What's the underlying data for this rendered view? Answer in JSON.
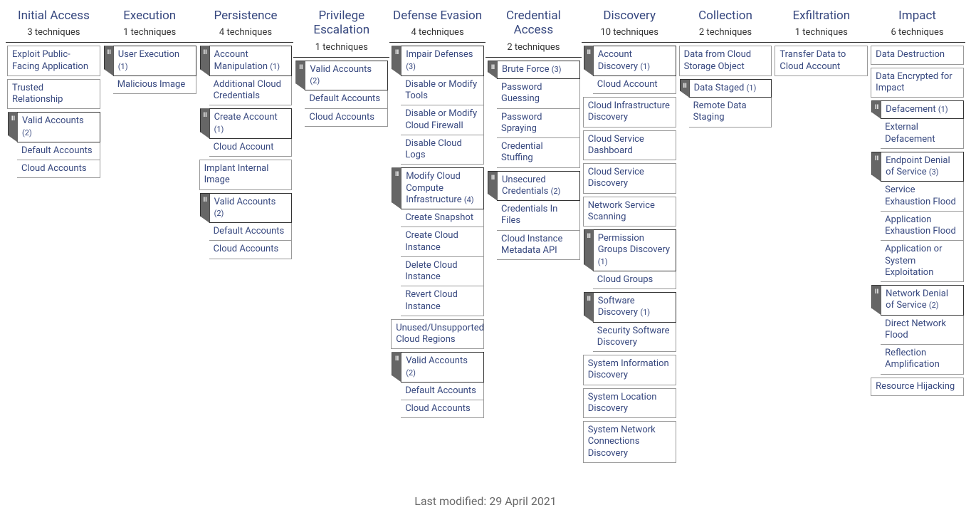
{
  "footer": "Last modified: 29 April 2021",
  "columns": [
    {
      "title": "Initial Access",
      "count": "3 techniques",
      "items": [
        {
          "type": "plain",
          "label": "Exploit Public-Facing Application"
        },
        {
          "type": "plain",
          "label": "Trusted Relationship"
        },
        {
          "type": "parent",
          "label": "Valid Accounts",
          "n": "(2)",
          "subs": [
            {
              "label": "Default Accounts"
            },
            {
              "label": "Cloud Accounts"
            }
          ]
        }
      ]
    },
    {
      "title": "Execution",
      "count": "1 techniques",
      "items": [
        {
          "type": "parent",
          "label": "User Execution",
          "n": "(1)",
          "subs": [
            {
              "label": "Malicious Image"
            }
          ]
        }
      ]
    },
    {
      "title": "Persistence",
      "count": "4 techniques",
      "items": [
        {
          "type": "parent",
          "label": "Account Manipulation",
          "n": "(1)",
          "subs": [
            {
              "label": "Additional Cloud Credentials"
            }
          ]
        },
        {
          "type": "parent",
          "label": "Create Account",
          "n": "(1)",
          "subs": [
            {
              "label": "Cloud Account"
            }
          ]
        },
        {
          "type": "plain",
          "label": "Implant Internal Image"
        },
        {
          "type": "parent",
          "label": "Valid Accounts",
          "n": "(2)",
          "subs": [
            {
              "label": "Default Accounts"
            },
            {
              "label": "Cloud Accounts"
            }
          ]
        }
      ]
    },
    {
      "title": "Privilege Escalation",
      "count": "1 techniques",
      "items": [
        {
          "type": "parent",
          "label": "Valid Accounts",
          "n": "(2)",
          "subs": [
            {
              "label": "Default Accounts"
            },
            {
              "label": "Cloud Accounts"
            }
          ]
        }
      ]
    },
    {
      "title": "Defense Evasion",
      "count": "4 techniques",
      "items": [
        {
          "type": "parent",
          "label": "Impair Defenses",
          "n": "(3)",
          "subs": [
            {
              "label": "Disable or Modify Tools"
            },
            {
              "label": "Disable or Modify Cloud Firewall"
            },
            {
              "label": "Disable Cloud Logs"
            }
          ]
        },
        {
          "type": "parent",
          "label": "Modify Cloud Compute Infrastructure",
          "n": "(4)",
          "subs": [
            {
              "label": "Create Snapshot"
            },
            {
              "label": "Create Cloud Instance"
            },
            {
              "label": "Delete Cloud Instance"
            },
            {
              "label": "Revert Cloud Instance"
            }
          ]
        },
        {
          "type": "plain",
          "label": "Unused/Unsupported Cloud Regions"
        },
        {
          "type": "parent",
          "label": "Valid Accounts",
          "n": "(2)",
          "subs": [
            {
              "label": "Default Accounts"
            },
            {
              "label": "Cloud Accounts"
            }
          ]
        }
      ]
    },
    {
      "title": "Credential Access",
      "count": "2 techniques",
      "items": [
        {
          "type": "parent",
          "label": "Brute Force",
          "n": "(3)",
          "subs": [
            {
              "label": "Password Guessing"
            },
            {
              "label": "Password Spraying"
            },
            {
              "label": "Credential Stuffing"
            }
          ]
        },
        {
          "type": "parent",
          "label": "Unsecured Credentials",
          "n": "(2)",
          "subs": [
            {
              "label": "Credentials In Files"
            },
            {
              "label": "Cloud Instance Metadata API"
            }
          ]
        }
      ]
    },
    {
      "title": "Discovery",
      "count": "10 techniques",
      "items": [
        {
          "type": "parent",
          "label": "Account Discovery",
          "n": "(1)",
          "subs": [
            {
              "label": "Cloud Account"
            }
          ]
        },
        {
          "type": "plain",
          "label": "Cloud Infrastructure Discovery"
        },
        {
          "type": "plain",
          "label": "Cloud Service Dashboard"
        },
        {
          "type": "plain",
          "label": "Cloud Service Discovery"
        },
        {
          "type": "plain",
          "label": "Network Service Scanning"
        },
        {
          "type": "parent",
          "label": "Permission Groups Discovery",
          "n": "(1)",
          "subs": [
            {
              "label": "Cloud Groups"
            }
          ]
        },
        {
          "type": "parent",
          "label": "Software Discovery",
          "n": "(1)",
          "subs": [
            {
              "label": "Security Software Discovery"
            }
          ]
        },
        {
          "type": "plain",
          "label": "System Information Discovery"
        },
        {
          "type": "plain",
          "label": "System Location Discovery"
        },
        {
          "type": "plain",
          "label": "System Network Connections Discovery"
        }
      ]
    },
    {
      "title": "Collection",
      "count": "2 techniques",
      "items": [
        {
          "type": "plain",
          "label": "Data from Cloud Storage Object"
        },
        {
          "type": "parent",
          "label": "Data Staged",
          "n": "(1)",
          "subs": [
            {
              "label": "Remote Data Staging"
            }
          ]
        }
      ]
    },
    {
      "title": "Exfiltration",
      "count": "1 techniques",
      "items": [
        {
          "type": "plain",
          "label": "Transfer Data to Cloud Account"
        }
      ]
    },
    {
      "title": "Impact",
      "count": "6 techniques",
      "items": [
        {
          "type": "plain",
          "label": "Data Destruction"
        },
        {
          "type": "plain",
          "label": "Data Encrypted for Impact"
        },
        {
          "type": "parent",
          "label": "Defacement",
          "n": "(1)",
          "subs": [
            {
              "label": "External Defacement"
            }
          ]
        },
        {
          "type": "parent",
          "label": "Endpoint Denial of Service",
          "n": "(3)",
          "subs": [
            {
              "label": "Service Exhaustion Flood"
            },
            {
              "label": "Application Exhaustion Flood"
            },
            {
              "label": "Application or System Exploitation"
            }
          ]
        },
        {
          "type": "parent",
          "label": "Network Denial of Service",
          "n": "(2)",
          "subs": [
            {
              "label": "Direct Network Flood"
            },
            {
              "label": "Reflection Amplification"
            }
          ]
        },
        {
          "type": "plain",
          "label": "Resource Hijacking"
        }
      ]
    }
  ]
}
